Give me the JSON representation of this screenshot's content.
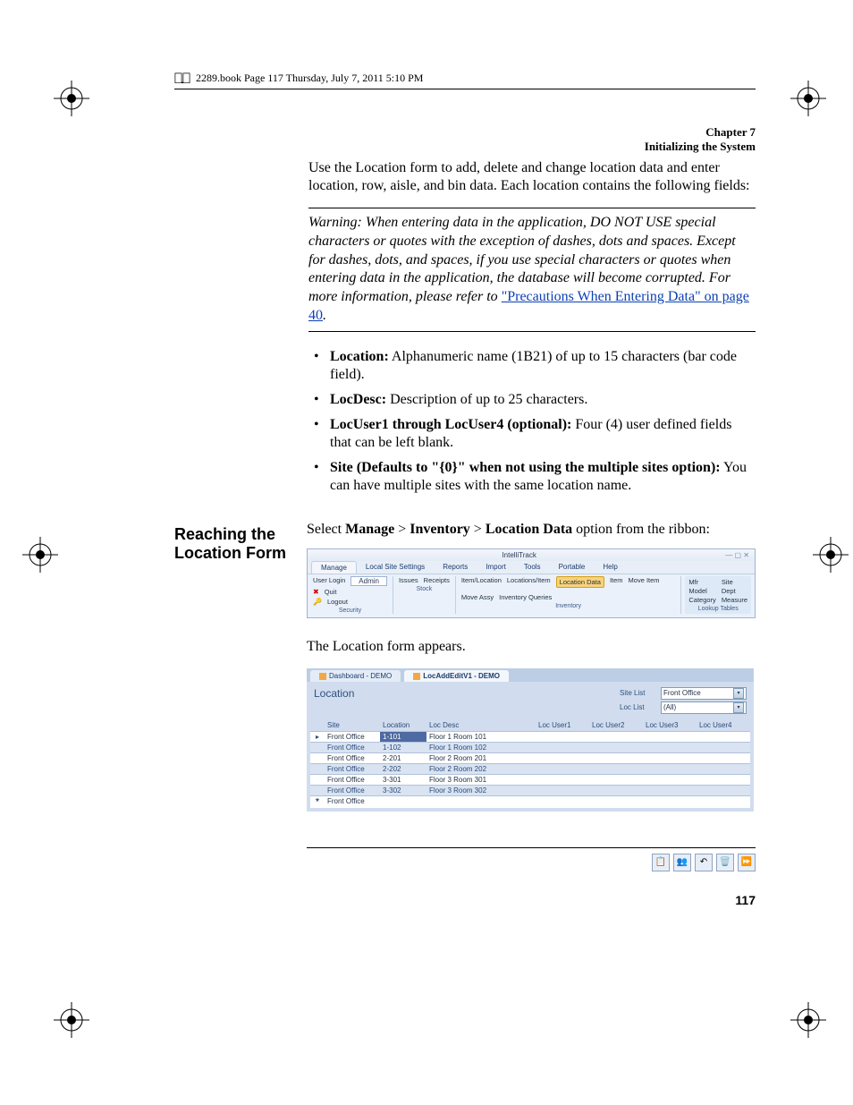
{
  "header": {
    "top_line": "2289.book  Page 117  Thursday, July 7, 2011  5:10 PM",
    "chapter_num": "Chapter 7",
    "chapter_title": "Initializing the System"
  },
  "intro_text": "Use the Location form to add, delete and change location data and enter location, row, aisle, and bin data. Each location contains the following fields:",
  "warning": {
    "prefix": "Warning:   When entering data in the application, DO NOT USE special characters or quotes with the exception of dashes, dots and spaces. Except for dashes, dots, and spaces, if you use special characters or quotes when entering data in the application, the database will become corrupted. For more information, please refer to ",
    "link_text": "\"Precautions When Entering Data\" on page 40",
    "suffix": "."
  },
  "fields": [
    {
      "name": "Location:",
      "desc": " Alphanumeric name (1B21) of up to 15 characters (bar code field)."
    },
    {
      "name": "LocDesc:",
      "desc": " Description of up to 25 characters."
    },
    {
      "name": "LocUser1 through LocUser4 (optional):",
      "desc": " Four (4) user defined fields that can be left blank."
    },
    {
      "name": "Site (Defaults to \"{0}\" when not using the multiple sites option):",
      "desc": " You can have multiple sites with the same location name."
    }
  ],
  "section_heading": "Reaching the Location Form",
  "nav_line": {
    "prefix": "Select ",
    "b1": "Manage",
    "sep": " > ",
    "b2": "Inventory",
    "b3": "Location Data",
    "suffix": " option from the ribbon:"
  },
  "ribbon": {
    "app_title": "IntelliTrack",
    "tabs": [
      "Manage",
      "Local Site Settings",
      "Reports",
      "Import",
      "Tools",
      "Portable",
      "Help"
    ],
    "active_tab": 0,
    "security": {
      "user_login_label": "User Login",
      "user_login_value": "Admin",
      "quit": "Quit",
      "logout": "Logout",
      "group_label": "Security"
    },
    "stock": {
      "items": [
        "Issues",
        "Receipts"
      ],
      "group_label": "Stock"
    },
    "inventory": {
      "items": [
        "Item/Location",
        "Locations/Item",
        "Location Data",
        "Item",
        "Move Item",
        "Move Assy",
        "Inventory Queries"
      ],
      "selected": 2,
      "group_label": "Inventory"
    },
    "lookup_tables": {
      "items": [
        "Mfr",
        "Site",
        "Model",
        "Dept",
        "Category",
        "Measure"
      ],
      "group_label": "Lookup Tables"
    }
  },
  "form_appears": "The Location form appears.",
  "location_form": {
    "tabs": [
      {
        "label": "Dashboard - DEMO",
        "active": false
      },
      {
        "label": "LocAddEditV1 - DEMO",
        "active": true
      }
    ],
    "title": "Location",
    "site_list_label": "Site List",
    "site_list_value": "Front Office",
    "loc_list_label": "Loc List",
    "loc_list_value": "(All)",
    "columns": [
      "",
      "Site",
      "Location",
      "Loc Desc",
      "Loc User1",
      "Loc User2",
      "Loc User3",
      "Loc User4"
    ],
    "rows": [
      {
        "sel": "tri",
        "site": "Front Office",
        "location": "1-101",
        "loc_desc": "Floor 1 Room 101",
        "highlight_location": true
      },
      {
        "sel": "",
        "site": "Front Office",
        "location": "1-102",
        "loc_desc": "Floor 1 Room 102"
      },
      {
        "sel": "",
        "site": "Front Office",
        "location": "2-201",
        "loc_desc": "Floor 2 Room 201"
      },
      {
        "sel": "",
        "site": "Front Office",
        "location": "2-202",
        "loc_desc": "Floor 2 Room 202"
      },
      {
        "sel": "",
        "site": "Front Office",
        "location": "3-301",
        "loc_desc": "Floor 3 Room 301"
      },
      {
        "sel": "",
        "site": "Front Office",
        "location": "3-302",
        "loc_desc": "Floor 3 Room 302"
      },
      {
        "sel": "star",
        "site": "Front Office",
        "location": "",
        "loc_desc": ""
      }
    ]
  },
  "toolbar_icons": [
    "📋",
    "👥",
    "↶",
    "🗑️",
    "⏩"
  ],
  "page_number": "117"
}
